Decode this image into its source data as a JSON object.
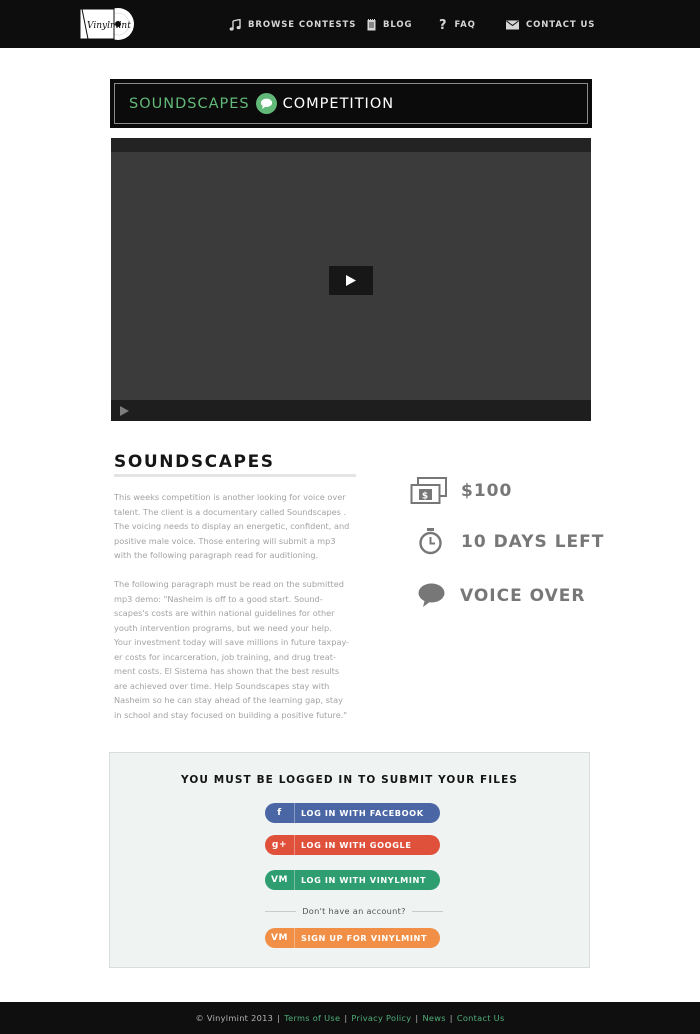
{
  "brand": {
    "logo_text": "Vinylmint"
  },
  "nav": {
    "items": [
      {
        "label": "BROWSE CONTESTS",
        "icon": "music-note-icon"
      },
      {
        "label": "BLOG",
        "icon": "notepad-icon"
      },
      {
        "label": "FAQ",
        "icon": "question-mark-icon"
      },
      {
        "label": "CONTACT US",
        "icon": "envelope-icon"
      }
    ]
  },
  "banner": {
    "name": "SOUNDSCAPES",
    "suffix": "COMPETITION",
    "accent": "#62b878"
  },
  "video": {
    "play_icon": "play-icon"
  },
  "contest": {
    "title": "SOUNDSCAPES",
    "paragraph1": "This weeks competition is another looking for voice over\ntalent. The client is a documentary called Soundscapes .\nThe voicing needs to display an energetic, confident, and\npositive male voice. Those entering will submit a mp3\nwith the following paragraph read for auditioning.",
    "paragraph2": "The following paragraph must be read on the submitted\nmp3 demo: \"Nasheim is off to a good start. Sound-\nscapes's costs are within national guidelines for other\nyouth intervention programs, but we need your help.\nYour investment today will save millions in future taxpay-\ner costs for incarceration, job training, and drug treat-\nment costs. El Sistema has shown that the best results\nare achieved over time. Help Soundscapes stay with\nNasheim so he can stay ahead of the learning gap, stay\nin school and stay focused on building a positive future.\"",
    "prize": "$100",
    "time_left": "10 DAYS LEFT",
    "category": "VOICE OVER"
  },
  "login": {
    "heading": "YOU MUST BE LOGGED IN TO SUBMIT YOUR FILES",
    "facebook": {
      "icon": "f",
      "label": "LOG IN WITH FACEBOOK",
      "color": "#4a66a4"
    },
    "google": {
      "icon": "g+",
      "label": "LOG IN WITH GOOGLE",
      "color": "#e0513c"
    },
    "vinylmint": {
      "icon": "VM",
      "label": "LOG IN WITH VINYLMINT",
      "color": "#2e9d6f"
    },
    "no_account": "Don't have an account?",
    "signup": {
      "icon": "VM",
      "label": "SIGN UP FOR VINYLMINT",
      "color": "#f08f45"
    }
  },
  "footer": {
    "copyright": "© Vinylmint 2013",
    "links": [
      "Terms of Use",
      "Privacy Policy",
      "News",
      "Contact Us"
    ]
  }
}
